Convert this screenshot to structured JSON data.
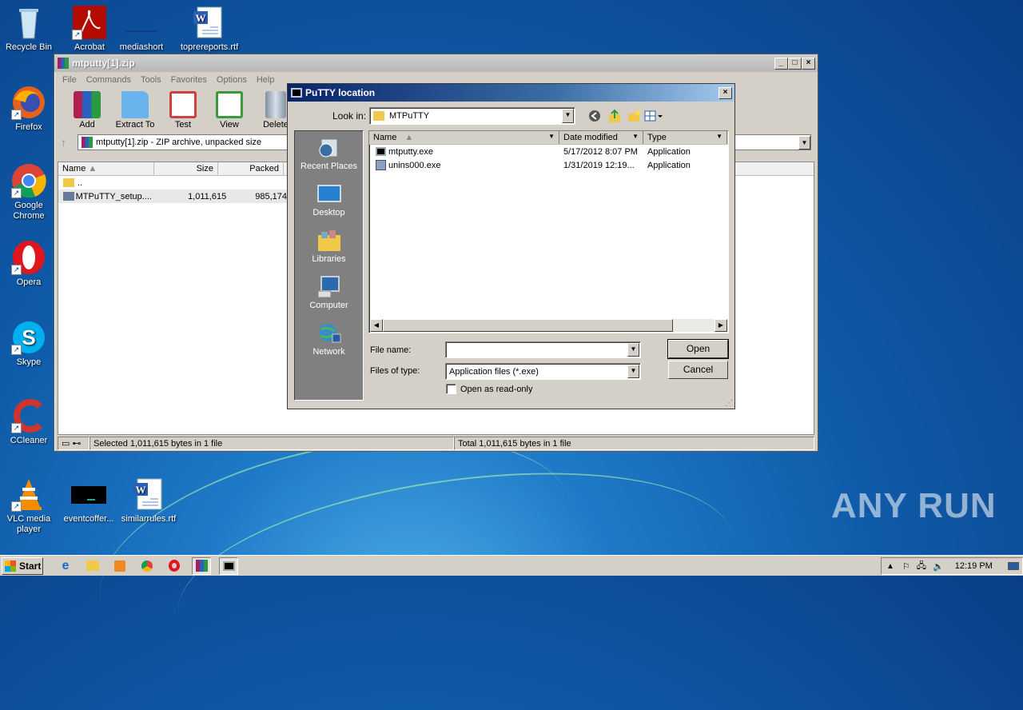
{
  "desktop": {
    "icons_left": [
      {
        "label": "Recycle Bin",
        "icon": "recycle-bin-icon"
      },
      {
        "label": "Firefox",
        "icon": "firefox-icon"
      },
      {
        "label": "Google Chrome",
        "icon": "chrome-icon"
      },
      {
        "label": "Opera",
        "icon": "opera-icon"
      },
      {
        "label": "Skype",
        "icon": "skype-icon"
      },
      {
        "label": "CCleaner",
        "icon": "ccleaner-icon"
      },
      {
        "label": "VLC media player",
        "icon": "vlc-icon"
      }
    ],
    "icons_top": [
      {
        "label": "Acrobat",
        "icon": "acrobat-icon"
      },
      {
        "label": "mediashort",
        "icon": "file-icon"
      },
      {
        "label": "toprereports.rtf",
        "icon": "word-doc-icon"
      }
    ],
    "icons_bottom": [
      {
        "label": "eventcoffer...",
        "icon": "black-window-icon"
      },
      {
        "label": "similarrules.rtf",
        "icon": "word-doc-icon"
      }
    ],
    "watermark": "ANY RUN"
  },
  "winrar": {
    "title": "mtputty[1].zip",
    "menu": [
      "File",
      "Commands",
      "Tools",
      "Favorites",
      "Options",
      "Help"
    ],
    "toolbar": [
      {
        "label": "Add",
        "icon": "add-archive-icon",
        "color": "#c03030"
      },
      {
        "label": "Extract To",
        "icon": "extract-folder-icon",
        "color": "#4aa0e0"
      },
      {
        "label": "Test",
        "icon": "test-clipboard-icon",
        "color": "#d04040"
      },
      {
        "label": "View",
        "icon": "view-book-icon",
        "color": "#3a9a3a"
      },
      {
        "label": "Delete",
        "icon": "delete-trash-icon",
        "color": "#8090a0"
      }
    ],
    "address": "mtputty[1].zip - ZIP archive, unpacked size",
    "columns": {
      "name": "Name",
      "size": "Size",
      "packed": "Packed"
    },
    "rows": [
      {
        "name": "..",
        "size": "",
        "packed": ""
      },
      {
        "name": "MTPuTTY_setup....",
        "size": "1,011,615",
        "packed": "985,174"
      }
    ],
    "status_left": "Selected 1,011,615 bytes in 1 file",
    "status_right": "Total 1,011,615 bytes in 1 file"
  },
  "dialog": {
    "title": "PuTTY location",
    "look_in_label": "Look in:",
    "look_in_value": "MTPuTTY",
    "places": [
      {
        "label": "Recent Places",
        "icon": "recent-places-icon"
      },
      {
        "label": "Desktop",
        "icon": "desktop-icon"
      },
      {
        "label": "Libraries",
        "icon": "libraries-icon"
      },
      {
        "label": "Computer",
        "icon": "computer-icon"
      },
      {
        "label": "Network",
        "icon": "network-icon"
      }
    ],
    "columns": {
      "name": "Name",
      "date": "Date modified",
      "type": "Type"
    },
    "files": [
      {
        "name": "mtputty.exe",
        "date": "5/17/2012 8:07 PM",
        "type": "Application"
      },
      {
        "name": "unins000.exe",
        "date": "1/31/2019 12:19...",
        "type": "Application"
      }
    ],
    "file_name_label": "File name:",
    "file_name_value": "",
    "files_of_type_label": "Files of type:",
    "files_of_type_value": "Application files (*.exe)",
    "read_only_label": "Open as read-only",
    "open_label": "Open",
    "cancel_label": "Cancel"
  },
  "taskbar": {
    "start_label": "Start",
    "clock": "12:19 PM"
  }
}
